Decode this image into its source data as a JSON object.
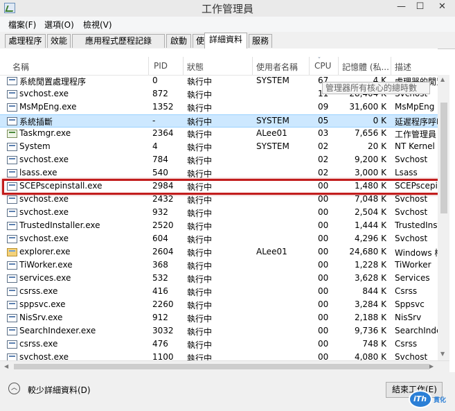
{
  "window": {
    "title": "工作管理員",
    "controls": {
      "minimize": "—",
      "maximize": "☐",
      "close": "✕"
    }
  },
  "menu": [
    "檔案(F)",
    "選項(O)",
    "檢視(V)"
  ],
  "tabs": [
    "處理程序",
    "效能",
    "應用程式歷程記錄",
    "啟動",
    "使用者",
    "詳細資料",
    "服務"
  ],
  "active_tab": "詳細資料",
  "columns": {
    "name": "名稱",
    "pid": "PID",
    "status": "狀態",
    "user": "使用者名稱",
    "cpu": "CPU",
    "memory": "記憶體 (私...",
    "description": "描述"
  },
  "rows": [
    {
      "name": "系統閒置處理程序",
      "pid": "0",
      "status": "執行中",
      "user": "SYSTEM",
      "cpu": "67",
      "memory": "4 K",
      "desc": "處理器的閒置"
    },
    {
      "name": "svchost.exe",
      "pid": "872",
      "status": "執行中",
      "user": "",
      "cpu": "11",
      "memory": "28,404 K",
      "desc": "Svchost"
    },
    {
      "name": "MsMpEng.exe",
      "pid": "1352",
      "status": "執行中",
      "user": "",
      "cpu": "09",
      "memory": "31,600 K",
      "desc": "MsMpEng"
    },
    {
      "name": "系統插斷",
      "pid": "-",
      "status": "執行中",
      "user": "SYSTEM",
      "cpu": "05",
      "memory": "0 K",
      "desc": "延遲程序呼叫"
    },
    {
      "name": "Taskmgr.exe",
      "pid": "2364",
      "status": "執行中",
      "user": "ALee01",
      "cpu": "03",
      "memory": "7,656 K",
      "desc": "工作管理員"
    },
    {
      "name": "System",
      "pid": "4",
      "status": "執行中",
      "user": "SYSTEM",
      "cpu": "02",
      "memory": "20 K",
      "desc": "NT Kernel &"
    },
    {
      "name": "svchost.exe",
      "pid": "784",
      "status": "執行中",
      "user": "",
      "cpu": "02",
      "memory": "9,200 K",
      "desc": "Svchost"
    },
    {
      "name": "lsass.exe",
      "pid": "540",
      "status": "執行中",
      "user": "",
      "cpu": "02",
      "memory": "3,000 K",
      "desc": "Lsass"
    },
    {
      "name": "SCEPscepinstall.exe",
      "pid": "2984",
      "status": "執行中",
      "user": "",
      "cpu": "00",
      "memory": "1,480 K",
      "desc": "SCEPscepin"
    },
    {
      "name": "svchost.exe",
      "pid": "2432",
      "status": "執行中",
      "user": "",
      "cpu": "00",
      "memory": "7,048 K",
      "desc": "Svchost"
    },
    {
      "name": "svchost.exe",
      "pid": "932",
      "status": "執行中",
      "user": "",
      "cpu": "00",
      "memory": "2,504 K",
      "desc": "Svchost"
    },
    {
      "name": "TrustedInstaller.exe",
      "pid": "2520",
      "status": "執行中",
      "user": "",
      "cpu": "00",
      "memory": "1,444 K",
      "desc": "TrustedInst"
    },
    {
      "name": "svchost.exe",
      "pid": "604",
      "status": "執行中",
      "user": "",
      "cpu": "00",
      "memory": "4,296 K",
      "desc": "Svchost"
    },
    {
      "name": "explorer.exe",
      "pid": "2604",
      "status": "執行中",
      "user": "ALee01",
      "cpu": "00",
      "memory": "24,680 K",
      "desc": "Windows 檔"
    },
    {
      "name": "TiWorker.exe",
      "pid": "368",
      "status": "執行中",
      "user": "",
      "cpu": "00",
      "memory": "1,228 K",
      "desc": "TiWorker"
    },
    {
      "name": "services.exe",
      "pid": "532",
      "status": "執行中",
      "user": "",
      "cpu": "00",
      "memory": "3,628 K",
      "desc": "Services"
    },
    {
      "name": "csrss.exe",
      "pid": "416",
      "status": "執行中",
      "user": "",
      "cpu": "00",
      "memory": "844 K",
      "desc": "Csrss"
    },
    {
      "name": "sppsvc.exe",
      "pid": "2260",
      "status": "執行中",
      "user": "",
      "cpu": "00",
      "memory": "3,284 K",
      "desc": "Sppsvc"
    },
    {
      "name": "NisSrv.exe",
      "pid": "912",
      "status": "執行中",
      "user": "",
      "cpu": "00",
      "memory": "2,188 K",
      "desc": "NisSrv"
    },
    {
      "name": "SearchIndexer.exe",
      "pid": "3032",
      "status": "執行中",
      "user": "",
      "cpu": "00",
      "memory": "9,736 K",
      "desc": "SearchInde"
    },
    {
      "name": "csrss.exe",
      "pid": "476",
      "status": "執行中",
      "user": "",
      "cpu": "00",
      "memory": "748 K",
      "desc": "Csrss"
    },
    {
      "name": "svchost.exe",
      "pid": "1100",
      "status": "執行中",
      "user": "",
      "cpu": "00",
      "memory": "4,080 K",
      "desc": "Svchost"
    }
  ],
  "selected_row": "系統插斷",
  "highlighted_row": "SCEPscepinstall.exe",
  "tooltip": "管理器所有核心的總時數",
  "footer": {
    "fewer_details": "較少詳細資料(D)",
    "end_task": "結束工作(E)"
  },
  "watermark": {
    "brand": "iThome",
    "mark": "iTh",
    "sub": "貫化"
  },
  "colors": {
    "selected_row_bg": "#cde8ff",
    "highlight_border": "#c21d1d"
  }
}
